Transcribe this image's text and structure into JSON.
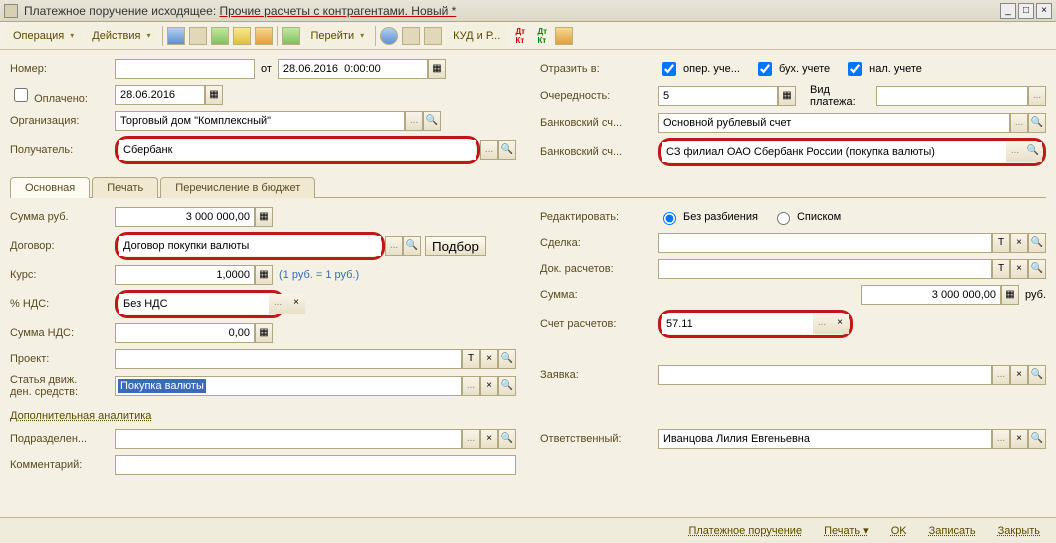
{
  "titlebar": {
    "prefix": "Платежное поручение исходящее: ",
    "main": "Прочие расчеты с контрагентами. Новый *"
  },
  "toolbar": {
    "operation": "Операция",
    "actions": "Действия",
    "goto": "Перейти",
    "kud": "КУД и Р..."
  },
  "left": {
    "number_label": "Номер:",
    "number": "",
    "ot": "от",
    "date_time": "28.06.2016  0:00:00",
    "paid_label": "Оплачено:",
    "paid_date": "28.06.2016",
    "org_label": "Организация:",
    "org": "Торговый дом \"Комплексный\"",
    "receiver_label": "Получатель:",
    "receiver": "Сбербанк"
  },
  "right": {
    "reflect_label": "Отразить в:",
    "chk1": "опер. уче...",
    "chk2": "бух. учете",
    "chk3": "нал. учете",
    "order_label": "Очередность:",
    "order": "5",
    "paytype_label": "Вид платежа:",
    "paytype": "",
    "bank1_label": "Банковский сч...",
    "bank1": "Основной рублевый счет",
    "bank2_label": "Банковский сч...",
    "bank2": "СЗ филиал ОАО Сбербанк России (покупка валюты)"
  },
  "tabs": {
    "main": "Основная",
    "print": "Печать",
    "budget": "Перечисление в бюджет"
  },
  "tab_left": {
    "sum_rub_label": "Сумма руб.",
    "sum_rub": "3 000 000,00",
    "contract_label": "Договор:",
    "contract": "Договор покупки валюты",
    "podbor": "Подбор",
    "rate_label": "Курс:",
    "rate": "1,0000",
    "rate_hint": "(1 руб. = 1 руб.)",
    "vat_pct_label": "% НДС:",
    "vat_pct": "Без НДС",
    "vat_sum_label": "Сумма НДС:",
    "vat_sum": "0,00",
    "project_label": "Проект:",
    "article_label1": "Статья движ.",
    "article_label2": "ден. средств:",
    "article": "Покупка валюты"
  },
  "tab_right": {
    "edit_label": "Редактировать:",
    "edit_opt1": "Без разбиения",
    "edit_opt2": "Списком",
    "deal_label": "Сделка:",
    "docs_label": "Док. расчетов:",
    "sum_label": "Сумма:",
    "sum": "3 000 000,00",
    "sum_unit": "руб.",
    "acct_label": "Счет расчетов:",
    "acct": "57.11",
    "request_label": "Заявка:"
  },
  "extra_section": "Дополнительная аналитика",
  "bottom": {
    "dept_label": "Подразделен...",
    "resp_label": "Ответственный:",
    "resp": "Иванцова Лилия Евгеньевна",
    "comment_label": "Комментарий:"
  },
  "footer": {
    "pp": "Платежное поручение",
    "print": "Печать",
    "ok": "OK",
    "save": "Записать",
    "close": "Закрыть"
  }
}
